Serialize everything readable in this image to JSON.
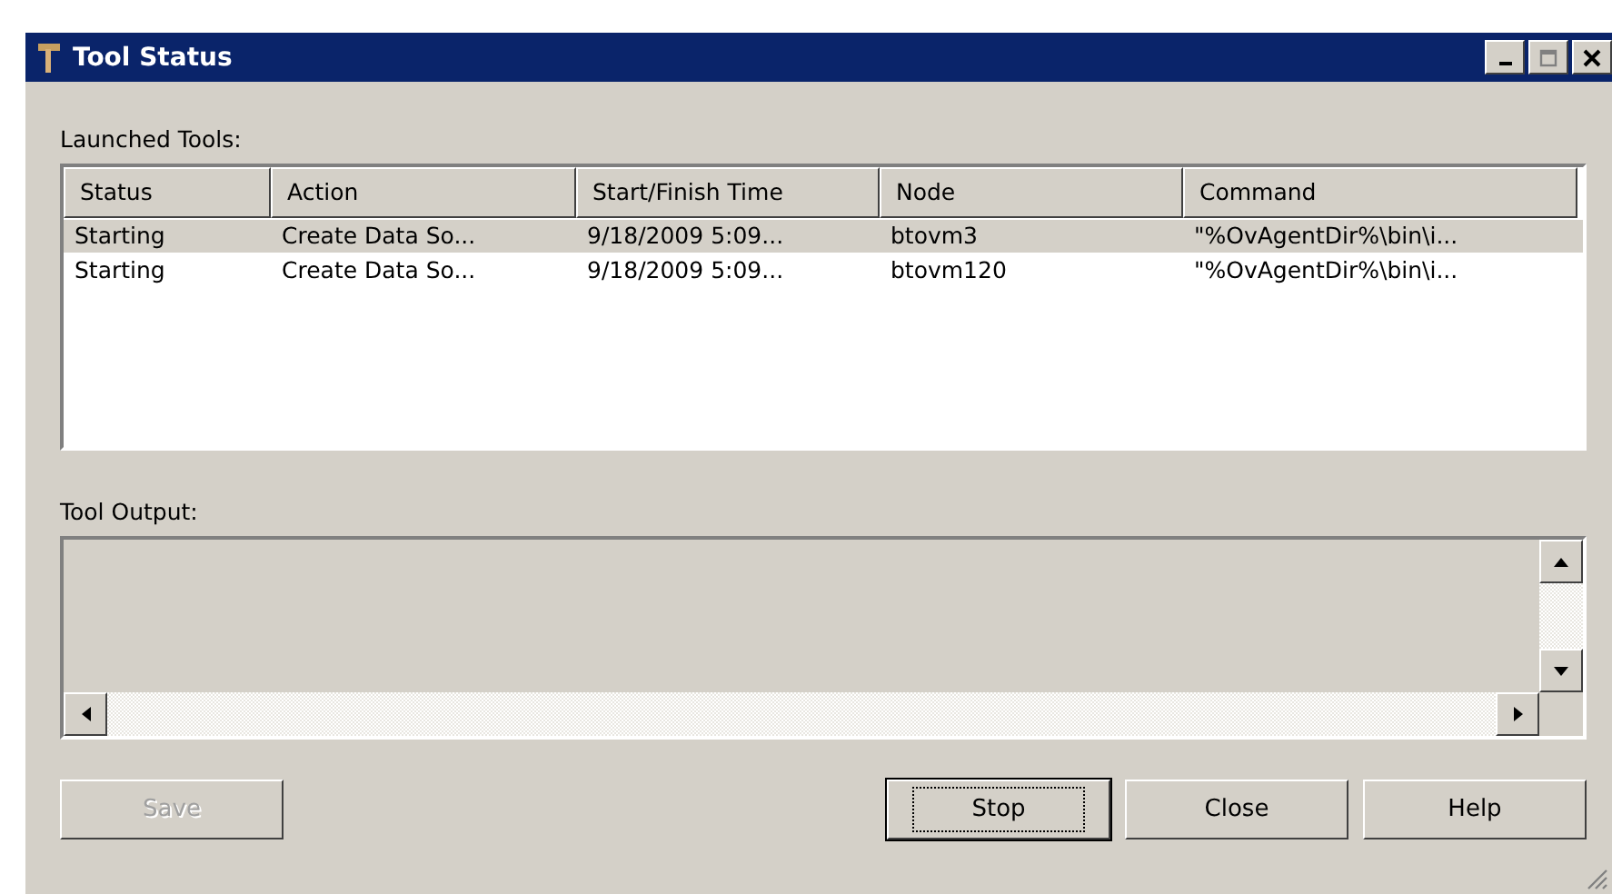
{
  "window": {
    "title": "Tool Status"
  },
  "launched_tools": {
    "label": "Launched Tools:",
    "columns": [
      "Status",
      "Action",
      "Start/Finish Time",
      "Node",
      "Command"
    ],
    "rows": [
      {
        "cells": [
          "Starting",
          "Create Data So...",
          "9/18/2009 5:09...",
          "btovm3",
          "\"%OvAgentDir%\\bin\\i..."
        ],
        "selected": true
      },
      {
        "cells": [
          "Starting",
          "Create Data So...",
          "9/18/2009 5:09...",
          "btovm120",
          "\"%OvAgentDir%\\bin\\i..."
        ],
        "selected": false
      }
    ]
  },
  "tool_output": {
    "label": "Tool Output:"
  },
  "buttons": [
    {
      "label": "Save",
      "disabled": true,
      "default": false
    },
    {
      "label": "Stop",
      "disabled": false,
      "default": true
    },
    {
      "label": "Close",
      "disabled": false,
      "default": false
    },
    {
      "label": "Help",
      "disabled": false,
      "default": false
    }
  ]
}
